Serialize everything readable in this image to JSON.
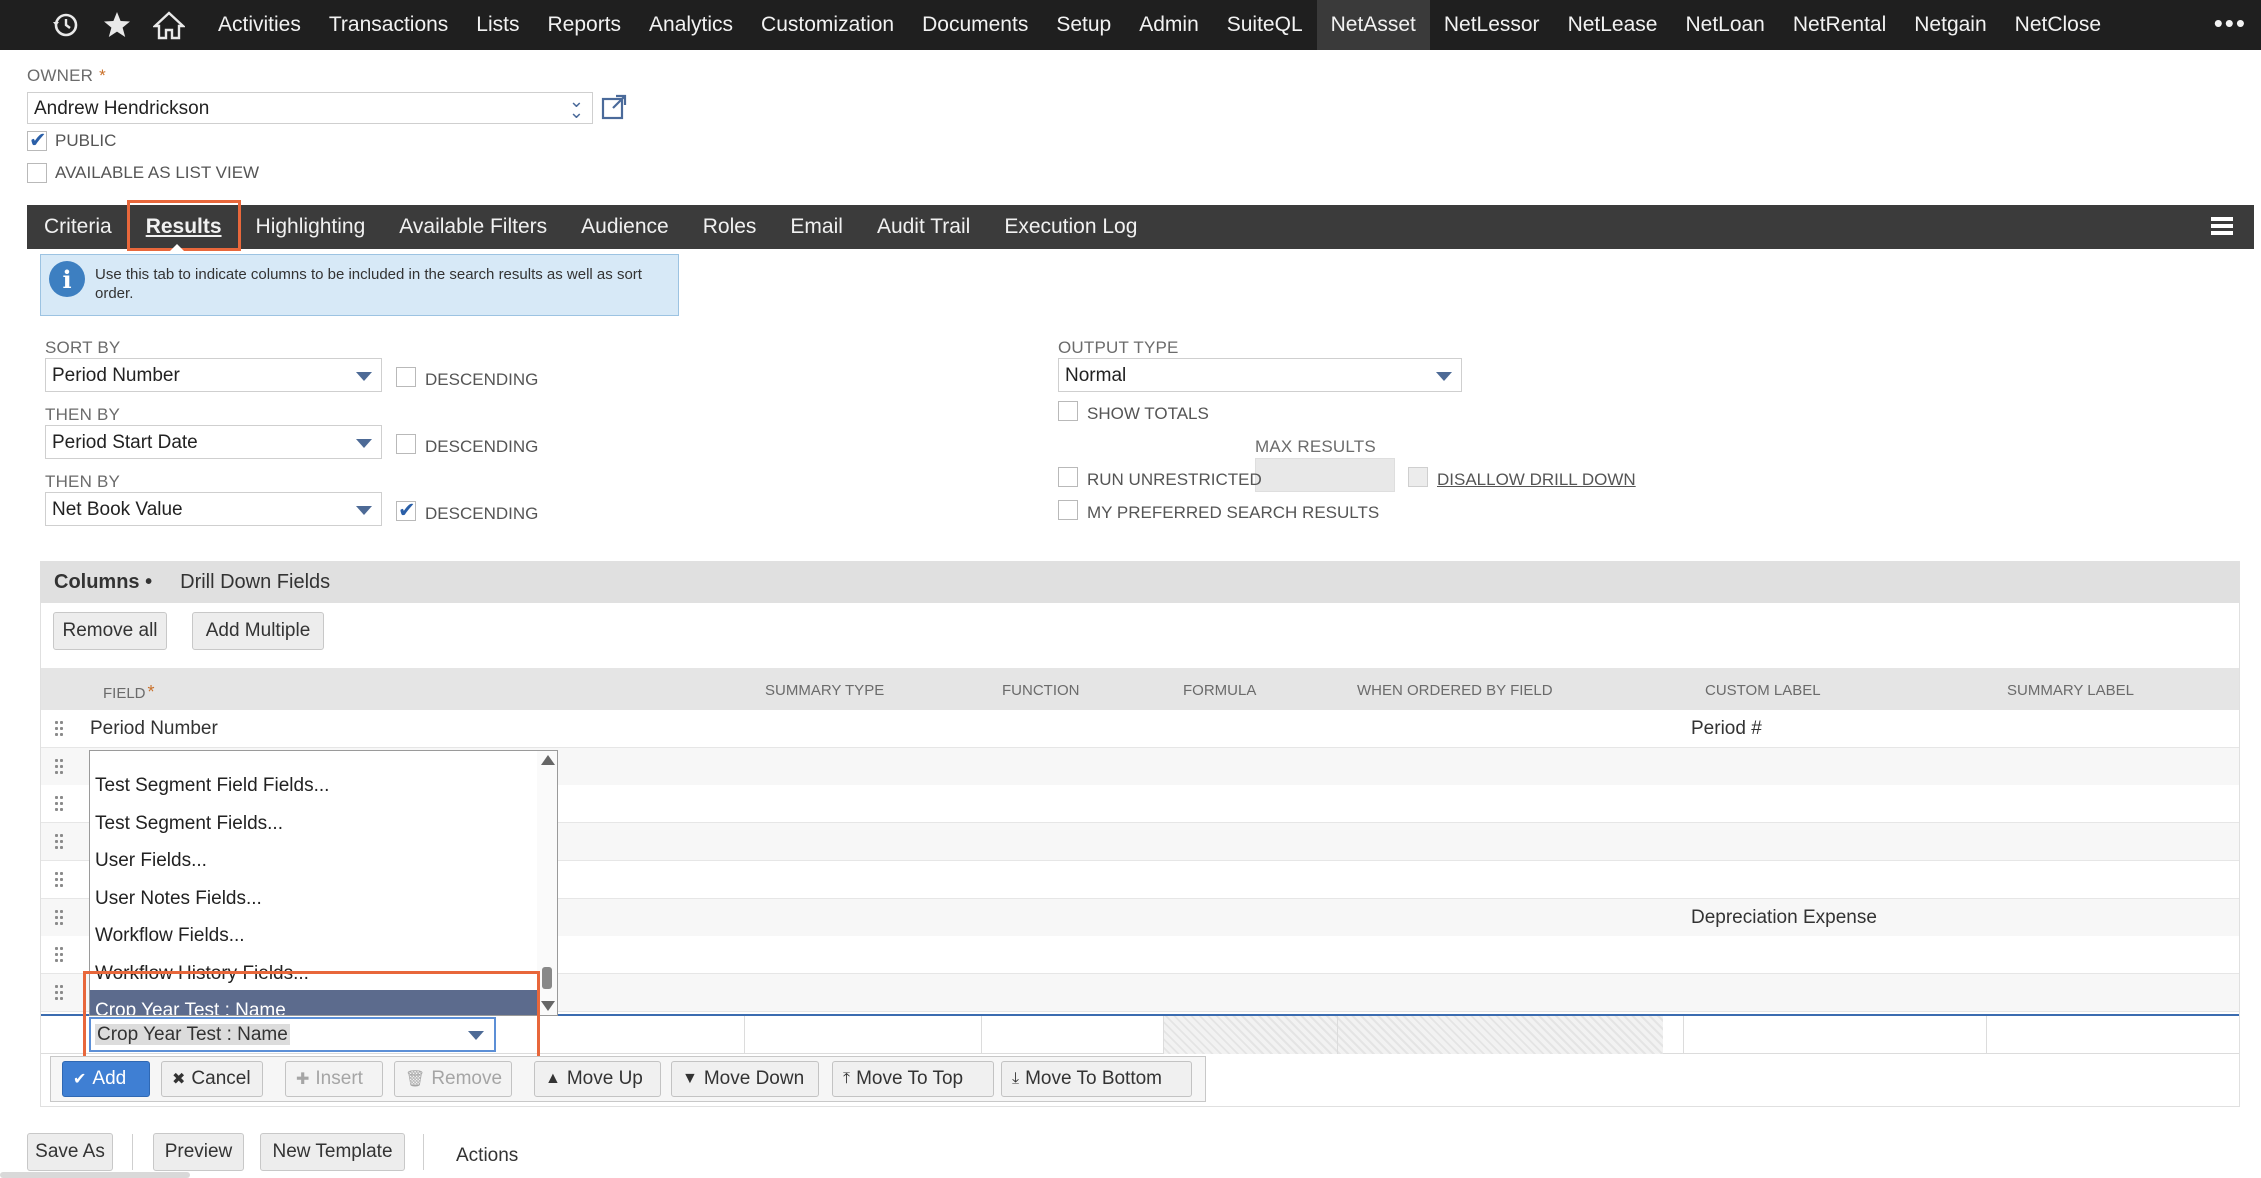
{
  "nav": {
    "icons": [
      "recent-history-icon",
      "star-icon",
      "home-icon"
    ],
    "links": [
      "Activities",
      "Transactions",
      "Lists",
      "Reports",
      "Analytics",
      "Customization",
      "Documents",
      "Setup",
      "Admin",
      "SuiteQL",
      "NetAsset",
      "NetLessor",
      "NetLease",
      "NetLoan",
      "NetRental",
      "Netgain",
      "NetClose"
    ],
    "active": "NetAsset",
    "more": "•••"
  },
  "owner": {
    "label": "OWNER",
    "required": "*",
    "value": "Andrew Hendrickson"
  },
  "checks": {
    "public_label": "PUBLIC",
    "public_checked": true,
    "list_view_label": "AVAILABLE AS LIST VIEW",
    "list_view_checked": false
  },
  "tabs": [
    "Criteria",
    "Results",
    "Highlighting",
    "Available Filters",
    "Audience",
    "Roles",
    "Email",
    "Audit Trail",
    "Execution Log"
  ],
  "active_tab": "Results",
  "info": "Use this tab to indicate columns to be included in the search results as well as sort order.",
  "sort": {
    "sort_by_label": "SORT BY",
    "sort_by_value": "Period Number",
    "then_by_1_label": "THEN BY",
    "then_by_1_value": "Period Start Date",
    "then_by_2_label": "THEN BY",
    "then_by_2_value": "Net Book Value",
    "descending_label": "DESCENDING",
    "descending_states": [
      false,
      false,
      true
    ]
  },
  "output": {
    "type_label": "OUTPUT TYPE",
    "type_value": "Normal",
    "show_totals_label": "SHOW TOTALS",
    "max_results_label": "MAX RESULTS",
    "run_unrestricted_label": "RUN UNRESTRICTED",
    "disallow_drill_down_label": "DISALLOW DRILL DOWN",
    "preferred_label": "MY PREFERRED SEARCH RESULTS"
  },
  "subtabs": {
    "columns": "Columns •",
    "drill_down": "Drill Down Fields"
  },
  "buttons": {
    "remove_all": "Remove all",
    "add_multiple": "Add Multiple"
  },
  "table": {
    "headers": {
      "field": "FIELD",
      "field_req": "*",
      "summary_type": "SUMMARY TYPE",
      "function": "FUNCTION",
      "formula": "FORMULA",
      "when_ordered": "WHEN ORDERED BY FIELD",
      "custom_label": "CUSTOM LABEL",
      "summary_label": "SUMMARY LABEL"
    },
    "rows": [
      {
        "field": "Period Number",
        "custom_label": "Period #"
      },
      {
        "field": "",
        "custom_label": ""
      },
      {
        "field": "",
        "custom_label": ""
      },
      {
        "field": "",
        "custom_label": ""
      },
      {
        "field": "",
        "custom_label": ""
      },
      {
        "field": "",
        "custom_label": "Depreciation Expense"
      },
      {
        "field": "",
        "custom_label": ""
      },
      {
        "field": "",
        "custom_label": ""
      }
    ]
  },
  "dropdown": {
    "items": [
      "Test Segment Field Fields...",
      "Test Segment Fields...",
      "User Fields...",
      "User Notes Fields...",
      "Workflow Fields...",
      "Workflow History Fields...",
      "Crop Year Test : Name"
    ],
    "selected": "Crop Year Test : Name"
  },
  "edit_row": {
    "field_value": "Crop Year Test : Name"
  },
  "actions": {
    "add": "Add",
    "cancel": "Cancel",
    "insert": "Insert",
    "remove": "Remove",
    "move_up": "Move Up",
    "move_down": "Move Down",
    "move_to_top": "Move To Top",
    "move_to_bottom": "Move To Bottom"
  },
  "footer": {
    "save_as": "Save As",
    "preview": "Preview",
    "new_template": "New Template",
    "actions": "Actions"
  },
  "colors": {
    "nav_bg": "#1f1f1f",
    "tab_bg": "#3b3b3b",
    "highlight": "#e8673b",
    "primary": "#3f7fd3",
    "selected_item": "#5c6b8d"
  }
}
